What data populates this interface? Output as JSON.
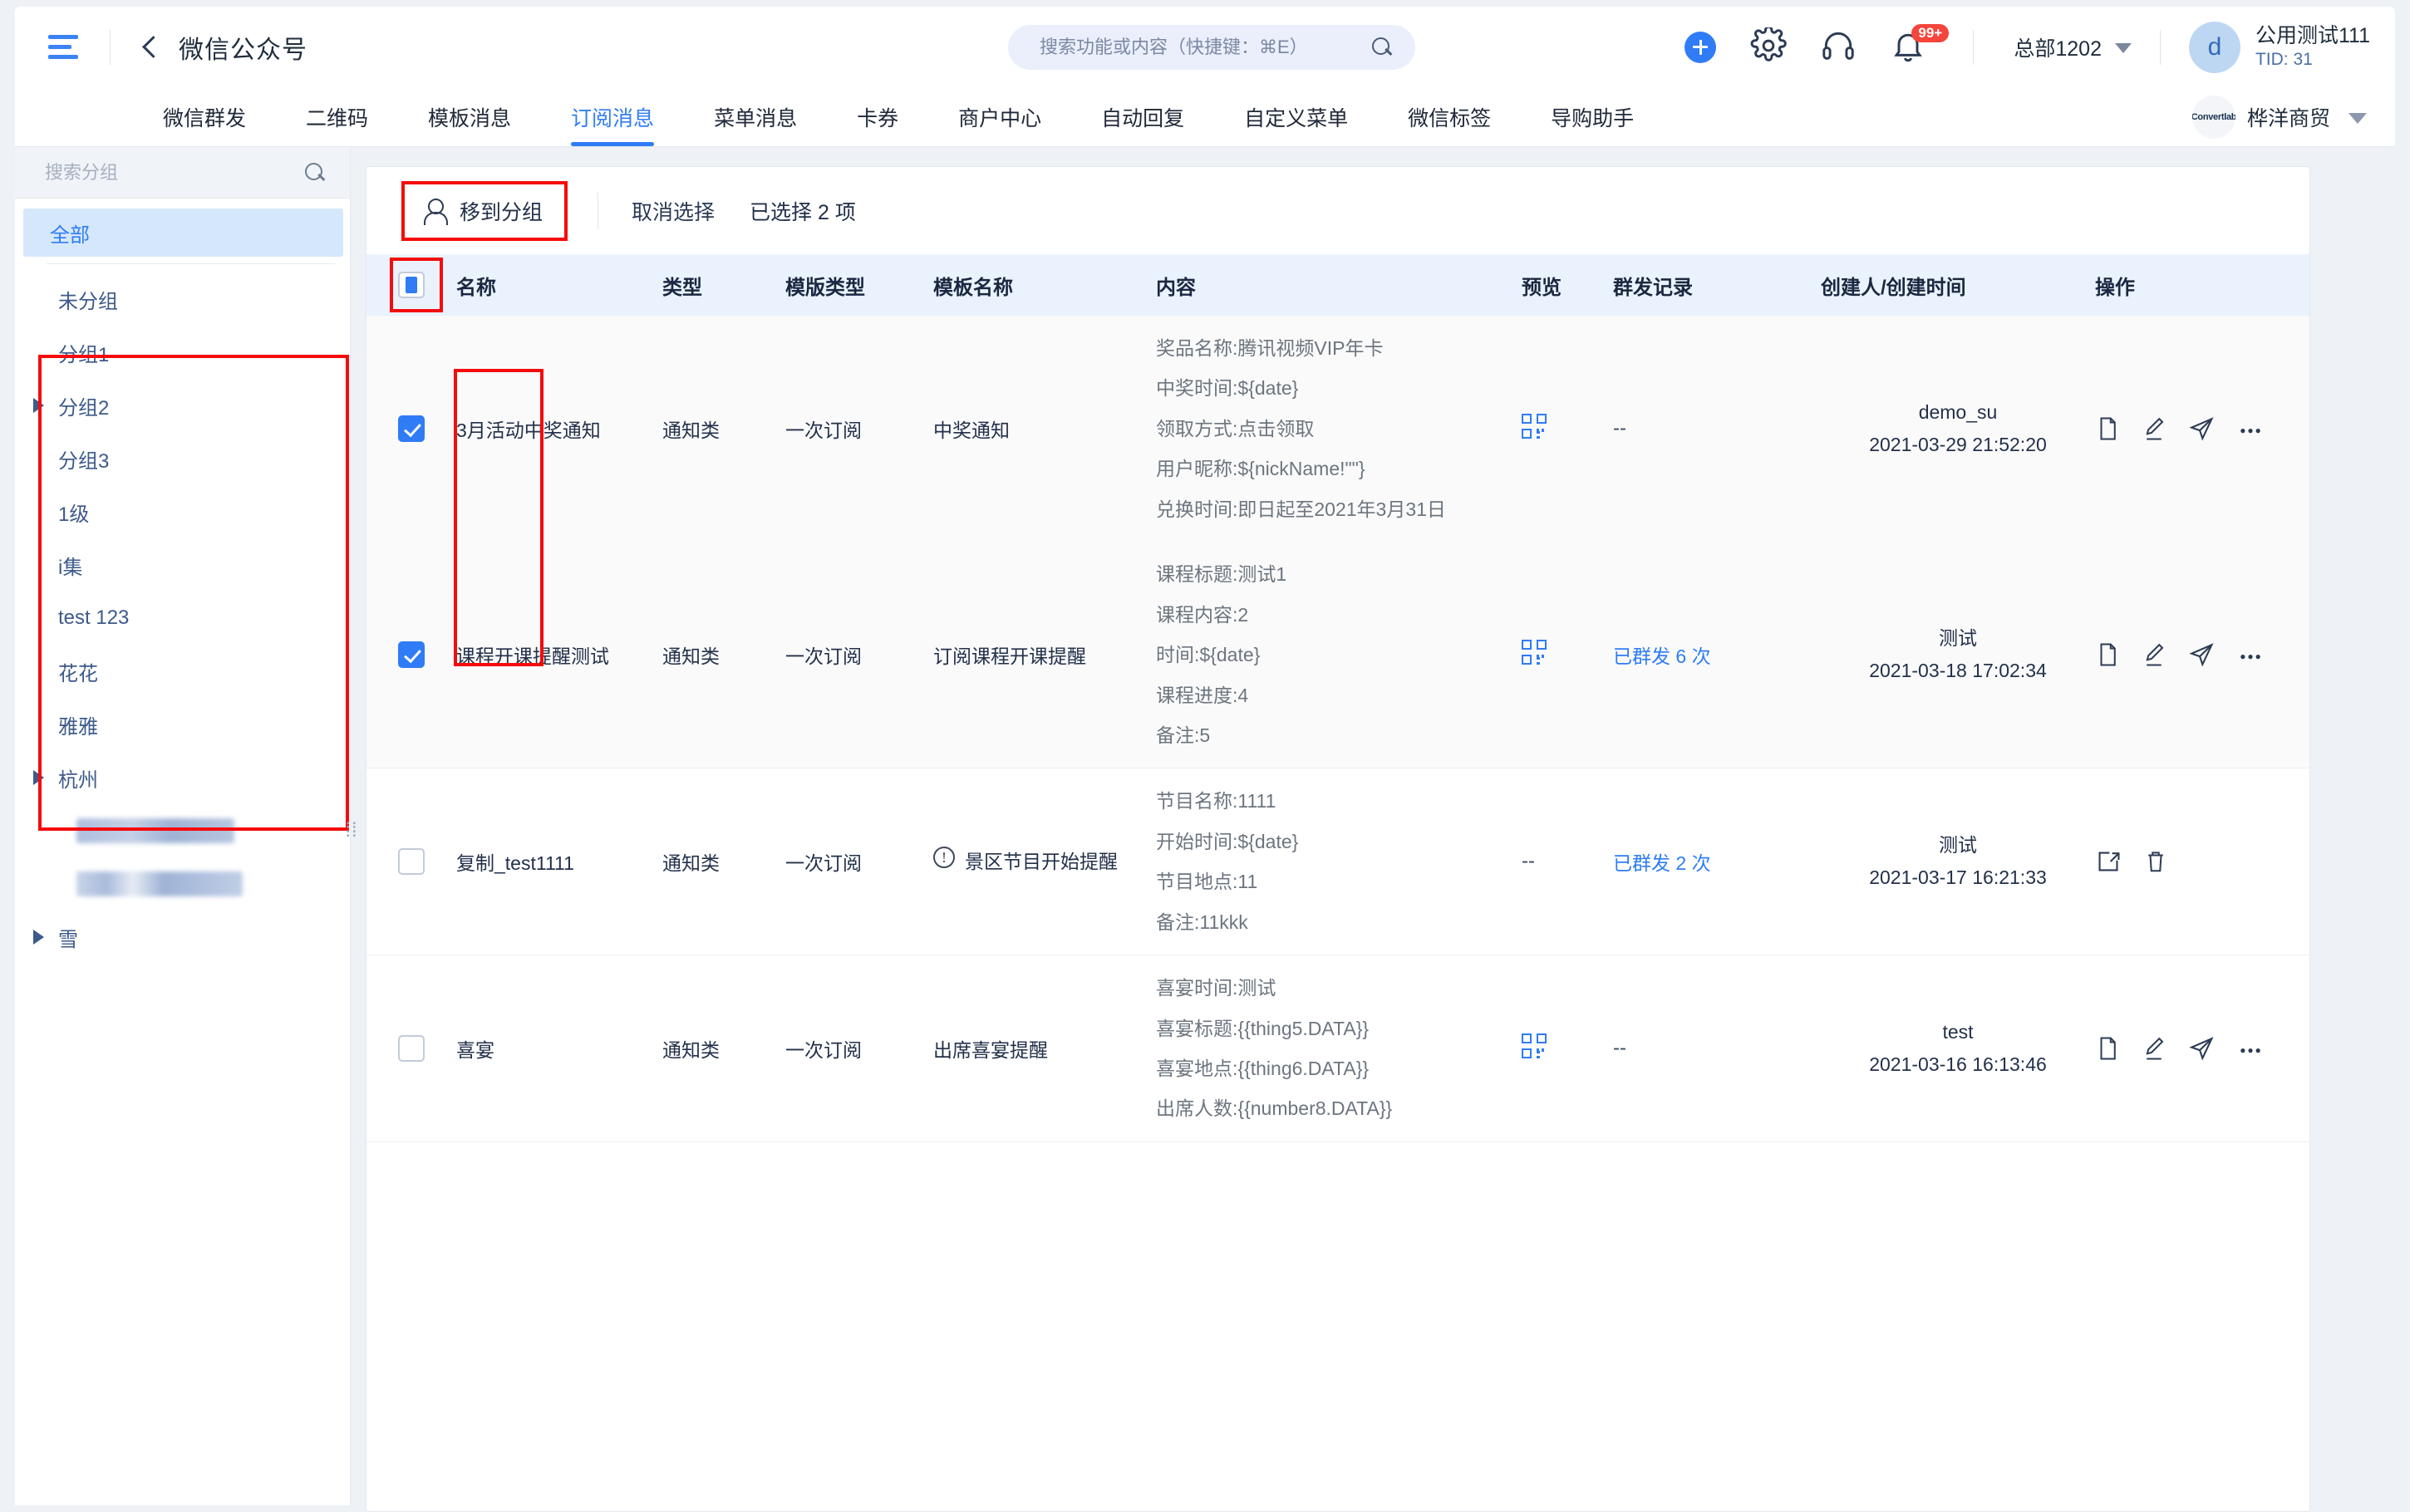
{
  "topbar": {
    "menu_icon": "hamburger-icon",
    "back_icon": "back-chevron-icon",
    "title": "微信公众号",
    "search": {
      "placeholder": "搜索功能或内容（快捷键：⌘E）",
      "value": "",
      "icon": "search-icon"
    },
    "add_icon": "plus-circle-icon",
    "settings_icon": "gear-icon",
    "support_icon": "headset-icon",
    "bell_icon": "bell-icon",
    "notification_badge": "99+",
    "department": "总部1202",
    "department_caret": "chevron-down-icon",
    "avatar_letter": "d",
    "user_name": "公用测试111",
    "user_tid": "TID: 31"
  },
  "nav": {
    "tabs": [
      {
        "label": "微信群发",
        "active": false
      },
      {
        "label": "二维码",
        "active": false
      },
      {
        "label": "模板消息",
        "active": false
      },
      {
        "label": "订阅消息",
        "active": true
      },
      {
        "label": "菜单消息",
        "active": false
      },
      {
        "label": "卡券",
        "active": false
      },
      {
        "label": "商户中心",
        "active": false
      },
      {
        "label": "自动回复",
        "active": false
      },
      {
        "label": "自定义菜单",
        "active": false
      },
      {
        "label": "微信标签",
        "active": false
      },
      {
        "label": "导购助手",
        "active": false
      }
    ],
    "brand_logo_text": "Convertlab",
    "brand_name": "桦洋商贸",
    "brand_caret": "chevron-down-icon"
  },
  "sidebar": {
    "search": {
      "placeholder": "搜索分组",
      "value": "",
      "icon": "search-icon"
    },
    "items": [
      {
        "label": "全部",
        "active": true,
        "expandable": false,
        "blurred": false
      },
      {
        "label": "未分组",
        "active": false,
        "expandable": false,
        "blurred": false
      },
      {
        "label": "分组1",
        "active": false,
        "expandable": false,
        "blurred": false
      },
      {
        "label": "分组2",
        "active": false,
        "expandable": true,
        "blurred": false
      },
      {
        "label": "分组3",
        "active": false,
        "expandable": false,
        "blurred": false
      },
      {
        "label": "1级",
        "active": false,
        "expandable": false,
        "blurred": false
      },
      {
        "label": "i集",
        "active": false,
        "expandable": false,
        "blurred": false
      },
      {
        "label": "test 123",
        "active": false,
        "expandable": false,
        "blurred": false
      },
      {
        "label": "花花",
        "active": false,
        "expandable": false,
        "blurred": false
      },
      {
        "label": "雅雅",
        "active": false,
        "expandable": false,
        "blurred": false
      },
      {
        "label": "杭州",
        "active": false,
        "expandable": true,
        "blurred": false
      },
      {
        "label": "",
        "active": false,
        "expandable": false,
        "blurred": true
      },
      {
        "label": "",
        "active": false,
        "expandable": false,
        "blurred": true
      },
      {
        "label": "雪",
        "active": false,
        "expandable": true,
        "blurred": false
      }
    ],
    "splitter": "⁞⁞"
  },
  "toolbar": {
    "move_group_icon": "person-icon",
    "move_group_label": "移到分组",
    "cancel_selection_label": "取消选择",
    "selected_count_label": "已选择 2 项"
  },
  "table": {
    "header_checkbox_state": "indeterminate",
    "columns": [
      "名称",
      "类型",
      "模版类型",
      "模板名称",
      "内容",
      "预览",
      "群发记录",
      "创建人/创建时间",
      "操作"
    ],
    "rows": [
      {
        "checked": true,
        "name": "3月活动中奖通知",
        "type": "通知类",
        "template_type": "一次订阅",
        "template_name": "中奖通知",
        "template_warning": false,
        "content": [
          "奖品名称:腾讯视频VIP年卡",
          "中奖时间:${date}",
          "领取方式:点击领取",
          "用户昵称:${nickName!\"\"}",
          "兑换时间:即日起至2021年3月31日"
        ],
        "preview": "qr-code-icon",
        "mass_record": "--",
        "mass_is_link": false,
        "creator": "demo_su",
        "created_at": "2021-03-29 21:52:20",
        "actions": [
          "copy-icon",
          "edit-icon",
          "send-icon",
          "more-icon"
        ]
      },
      {
        "checked": true,
        "name": "课程开课提醒测试",
        "type": "通知类",
        "template_type": "一次订阅",
        "template_name": "订阅课程开课提醒",
        "template_warning": false,
        "content": [
          "课程标题:测试1",
          "课程内容:2",
          "时间:${date}",
          "课程进度:4",
          "备注:5"
        ],
        "preview": "qr-code-icon",
        "mass_record": "已群发 6 次",
        "mass_is_link": true,
        "creator": "测试",
        "created_at": "2021-03-18 17:02:34",
        "actions": [
          "copy-icon",
          "edit-icon",
          "send-icon",
          "more-icon"
        ]
      },
      {
        "checked": false,
        "name": "复制_test1111",
        "type": "通知类",
        "template_type": "一次订阅",
        "template_name": "景区节目开始提醒",
        "template_warning": true,
        "content": [
          "节目名称:1111",
          "开始时间:${date}",
          "节目地点:11",
          "备注:11kkk"
        ],
        "preview": "--",
        "mass_record": "已群发 2 次",
        "mass_is_link": true,
        "creator": "测试",
        "created_at": "2021-03-17 16:21:33",
        "actions": [
          "restore-icon",
          "trash-icon"
        ]
      },
      {
        "checked": false,
        "name": "喜宴",
        "type": "通知类",
        "template_type": "一次订阅",
        "template_name": "出席喜宴提醒",
        "template_warning": false,
        "content": [
          "喜宴时间:测试",
          "喜宴标题:{{thing5.DATA}}",
          "喜宴地点:{{thing6.DATA}}",
          "出席人数:{{number8.DATA}}"
        ],
        "preview": "qr-code-icon",
        "mass_record": "--",
        "mass_is_link": false,
        "creator": "test",
        "created_at": "2021-03-16 16:13:46",
        "actions": [
          "copy-icon",
          "edit-icon",
          "send-icon",
          "more-icon"
        ]
      }
    ]
  },
  "colors": {
    "accent": "#2f7cf6",
    "highlight_outline": "#f50b0b",
    "header_bg": "#eaf2fd",
    "page_bg": "#eef1f6"
  }
}
